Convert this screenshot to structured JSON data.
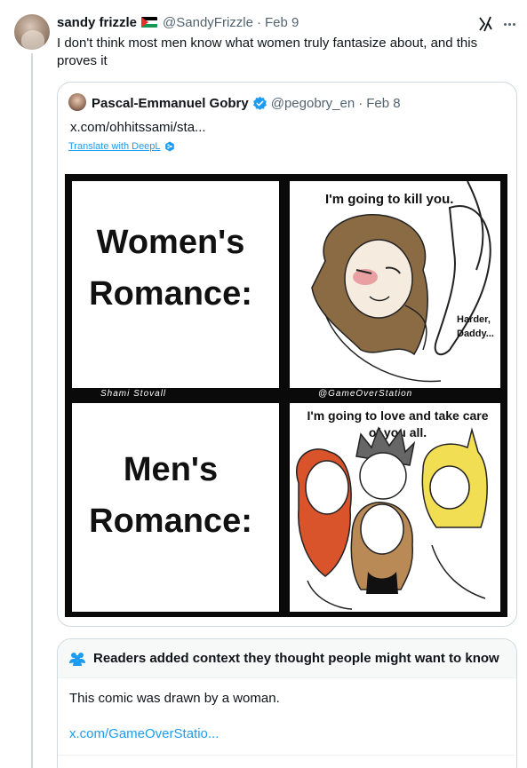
{
  "author": {
    "name": "sandy frizzle",
    "handle": "@SandyFrizzle",
    "date": "Feb 9",
    "flag_icon": "palestine-flag-icon"
  },
  "tweet": {
    "text": "I don't think most men know what women truly fantasize about, and this proves it"
  },
  "quoted": {
    "name": "Pascal-Emmanuel Gobry",
    "handle": "@pegobry_en",
    "date": "Feb 8",
    "verified_icon": "verified-badge-icon",
    "link": "x.com/ohhitssami/sta...",
    "translate_label": "Translate with DeepL",
    "comic": {
      "panel_tl_caption": "Women's Romance:",
      "panel_tr_speech_top": "I'm going to kill you.",
      "panel_tr_speech_bottom": "Harder, Daddy...",
      "credit_left": "Shami Stovall",
      "credit_right": "@GameOverStation",
      "panel_bl_caption": "Men's Romance:",
      "panel_br_speech": "I'm going to love and take care of you all."
    }
  },
  "community_note": {
    "heading": "Readers added context they thought people might want to know",
    "body": "This comic was drawn by a woman.",
    "link": "x.com/GameOverStatio..."
  },
  "colors": {
    "link": "#1d9bf0",
    "muted": "#536471",
    "border": "#cfd9de"
  }
}
